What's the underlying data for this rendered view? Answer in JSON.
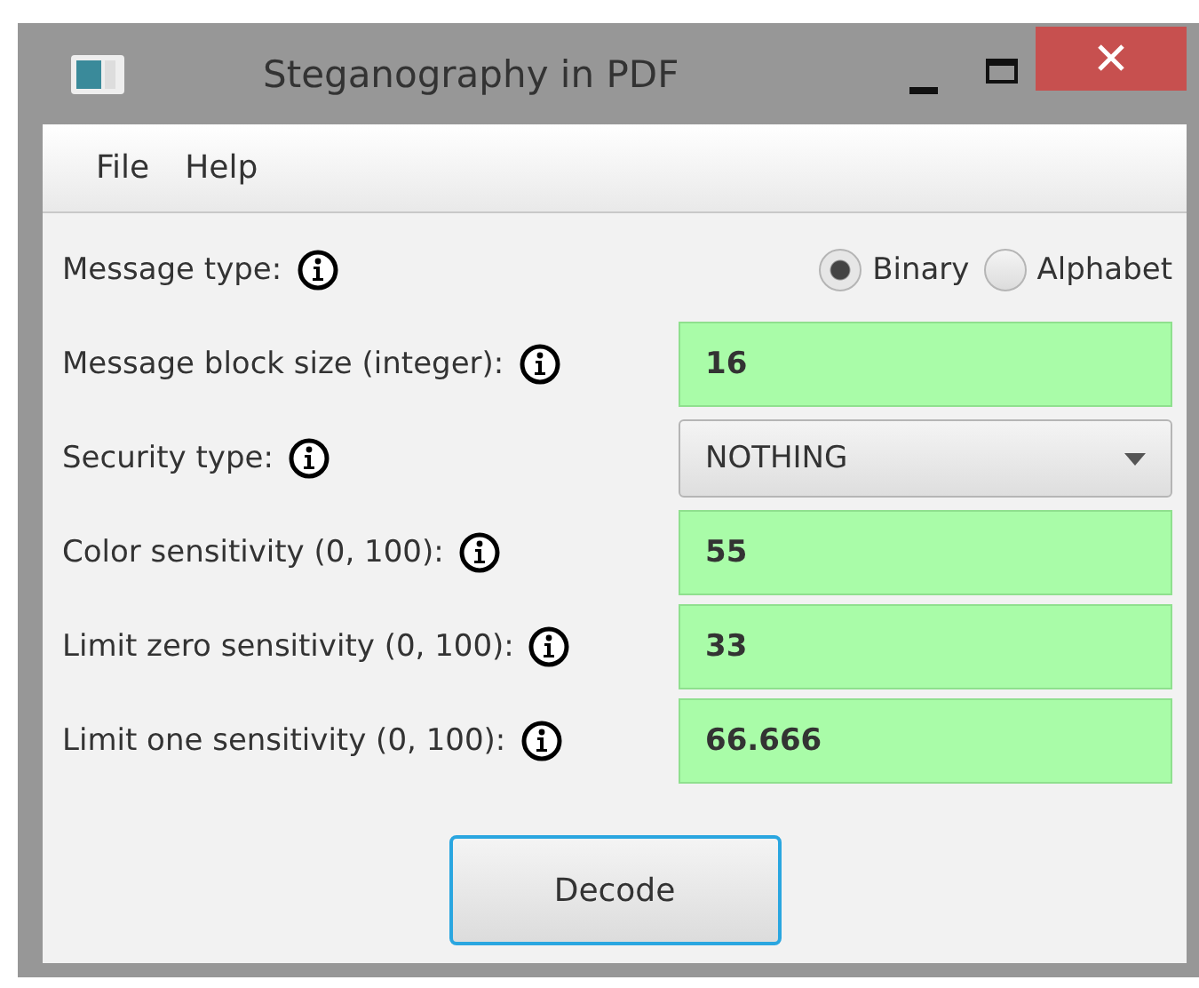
{
  "window": {
    "title": "Steganography in PDF"
  },
  "menu": [
    "File",
    "Help"
  ],
  "fields": [
    {
      "kind": "radio",
      "label": "Message type:",
      "options": [
        {
          "label": "Binary",
          "selected": true
        },
        {
          "label": "Alphabet",
          "selected": false
        }
      ]
    },
    {
      "kind": "text",
      "label": "Message block size (integer):",
      "value": "16"
    },
    {
      "kind": "select",
      "label": "Security type:",
      "value": "NOTHING"
    },
    {
      "kind": "text",
      "label": "Color sensitivity (0, 100):",
      "value": "55"
    },
    {
      "kind": "text",
      "label": "Limit zero sensitivity (0, 100):",
      "value": "33"
    },
    {
      "kind": "text",
      "label": "Limit one sensitivity (0, 100):",
      "value": "66.666"
    }
  ],
  "button": "Decode"
}
